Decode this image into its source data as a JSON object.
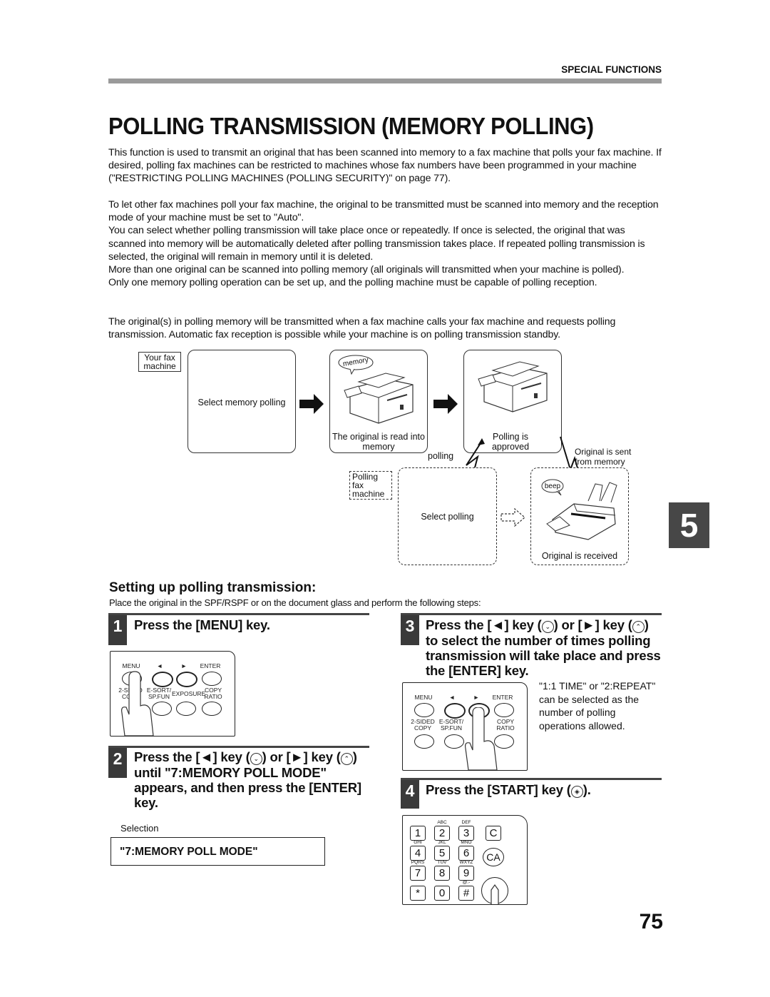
{
  "header": {
    "section_label": "SPECIAL FUNCTIONS",
    "page_title": "POLLING TRANSMISSION (MEMORY POLLING)"
  },
  "intro": {
    "p1": "This function is used to transmit an original that has been scanned into memory to a fax machine that polls your fax machine. If desired, polling fax machines can be restricted to machines whose fax numbers have been programmed in your machine (\"RESTRICTING POLLING MACHINES (POLLING SECURITY)\" on page 77).",
    "p2": "To let other fax machines poll your fax machine, the original to be transmitted must be scanned into memory and the reception mode of your machine must be set to \"Auto\".",
    "p3": "You can select whether polling transmission will take place once or repeatedly. If once is selected, the original that was scanned into memory will be automatically deleted after polling transmission takes place. If repeated polling transmission is selected, the original will remain in memory until it is deleted.",
    "p4": "More than one original can be scanned into polling memory (all originals will transmitted when your machine is polled).",
    "p5": "Only one memory polling operation can be set up, and the polling machine must be capable of polling reception.",
    "p6": "The original(s) in polling memory will be transmitted when a fax machine calls your fax machine and requests polling transmission. Automatic fax reception is possible while your machine is on polling transmission standby."
  },
  "diagram": {
    "your_fax_tag": "Your fax machine",
    "select_memory_polling": "Select memory polling",
    "memory_bubble": "memory",
    "read_into_memory": "The original is read into memory",
    "polling_approved": "Polling is approved",
    "polling_label": "polling",
    "original_sent": "Original is sent from memory",
    "polling_fax_tag": "Polling fax machine",
    "select_polling": "Select polling",
    "beep_bubble": "beep",
    "original_received": "Original is received"
  },
  "setup": {
    "heading": "Setting up polling transmission:",
    "intro": "Place the original in the SPF/RSPF or on the document glass and perform the following steps:"
  },
  "steps": [
    {
      "num": "1",
      "text": "Press the [MENU] key."
    },
    {
      "num": "2",
      "line1_a": "Press the [",
      "line1_b": "] key (",
      "line1_c": ") or [",
      "line1_d": "] key (",
      "line1_e": ")",
      "rest": "until \"7:MEMORY POLL MODE\" appears, and then press the [ENTER] key."
    },
    {
      "num": "3",
      "line1_a": "Press the [",
      "line1_b": "] key (",
      "line1_c": ") or [",
      "line1_d": "] key (",
      "line1_e": ")",
      "rest": "to select the number of times polling transmission will take place and press the [ENTER] key."
    },
    {
      "num": "4",
      "text_a": "Press the  [START] key (",
      "text_b": ")."
    }
  ],
  "step2_selection": {
    "caption": "Selection",
    "value": "\"7:MEMORY POLL MODE\""
  },
  "step3_note": "\"1:1 TIME\" or \"2:REPEAT\" can be selected as the number of polling operations allowed.",
  "panel": {
    "menu": "MENU",
    "enter": "ENTER",
    "left_arrow": "◄",
    "right_arrow": "►",
    "two_sided": "2-SIDED COPY",
    "esort": "E-SORT/ SP.FUN",
    "exposure": "EXPOSURE",
    "copy_ratio": "COPY RATIO"
  },
  "keypad": {
    "keys": [
      "1",
      "2",
      "3",
      "4",
      "5",
      "6",
      "7",
      "8",
      "9",
      "*",
      "0",
      "#"
    ],
    "subs": [
      "",
      "ABC",
      "DEF",
      "GHI",
      "JKL",
      "MNO",
      "PQRS",
      "TUV",
      "WXYZ",
      "",
      "",
      "@.-"
    ],
    "c": "C",
    "ca": "CA"
  },
  "icons": {
    "down_key": "⌄",
    "up_key": "⌃",
    "left_tri": "◄",
    "right_tri": "►",
    "start": "◈"
  },
  "chapter_tab": "5",
  "page_number": "75"
}
